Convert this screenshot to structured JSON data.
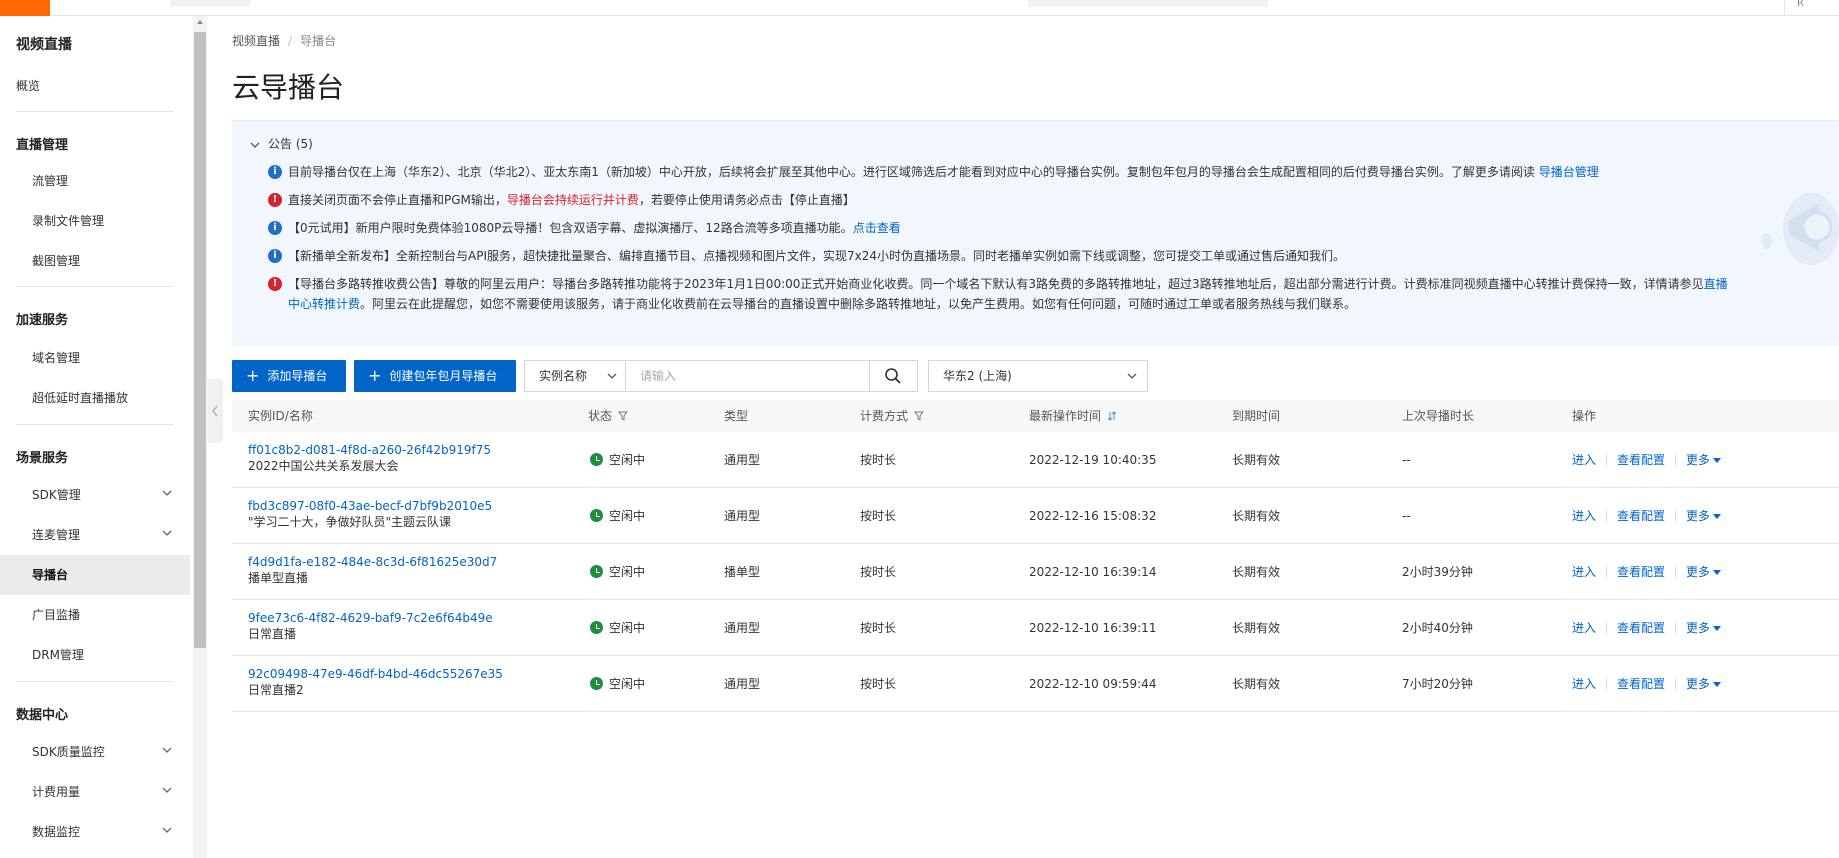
{
  "topbar": {
    "right_text": "R"
  },
  "sidebar": {
    "title": "视频直播",
    "overview": "概览",
    "groups": {
      "live_mgmt": "直播管理",
      "accel": "加速服务",
      "scene": "场景服务",
      "data_center": "数据中心"
    },
    "items": {
      "stream": "流管理",
      "record": "录制文件管理",
      "snapshot": "截图管理",
      "domain": "域名管理",
      "ultra": "超低延时直播播放",
      "sdk": "SDK管理",
      "mic": "连麦管理",
      "director": "导播台",
      "monitor": "广目监播",
      "drm": "DRM管理",
      "sdk_quality": "SDK质量监控",
      "billing": "计费用量",
      "data_monitor": "数据监控"
    }
  },
  "breadcrumb": {
    "root": "视频直播",
    "sep": "/",
    "current": "导播台"
  },
  "page_title": "云导播台",
  "notice": {
    "header": "公告 (5)",
    "rows": [
      {
        "type": "info",
        "text": "目前导播台仅在上海（华东2）、北京（华北2）、亚太东南1（新加坡）中心开放，后续将会扩展至其他中心。进行区域筛选后才能看到对应中心的导播台实例。复制包年包月的导播台会生成配置相同的后付费导播台实例。了解更多请阅读 ",
        "link": "导播台管理"
      },
      {
        "type": "warn",
        "text_a": "直接关闭页面不会停止直播和PGM输出，",
        "text_red": "导播台会持续运行并计费",
        "text_b": "，若要停止使用请务必点击【停止直播】"
      },
      {
        "type": "info",
        "text": "【0元试用】新用户限时免费体验1080P云导播！包含双语字幕、虚拟演播厅、12路合流等多项直播功能。",
        "link": "点击查看"
      },
      {
        "type": "info",
        "text": "【新播单全新发布】全新控制台与API服务，超快捷批量聚合、编排直播节目、点播视频和图片文件，实现7x24小时伪直播场景。同时老播单实例如需下线或调整，您可提交工单或通过售后通知我们。"
      },
      {
        "type": "warn",
        "text_a": "【导播台多路转推收费公告】尊敬的阿里云用户：导播台多路转推功能将于2023年1月1日00:00正式开始商业化收费。同一个域名下默认有3路免费的多路转推地址，超过3路转推地址后，超出部分需进行计费。计费标准同视频直播中心转推计费保持一致，详情请参见",
        "link": "直播中心转推计费",
        "text_b": "。阿里云在此提醒您，如您不需要使用该服务，请于商业化收费前在云导播台的直播设置中删除多路转推地址，以免产生费用。如您有任何问题，可随时通过工单或者服务热线与我们联系。"
      }
    ]
  },
  "toolbar": {
    "add_btn": "添加导播台",
    "create_btn": "创建包年包月导播台",
    "filter_select": "实例名称",
    "search_placeholder": "请输入",
    "region_select": "华东2 (上海)"
  },
  "table": {
    "headers": {
      "id": "实例ID/名称",
      "status": "状态",
      "type": "类型",
      "billing": "计费方式",
      "latest": "最新操作时间",
      "expire": "到期时间",
      "last_duration": "上次导播时长",
      "ops": "操作"
    },
    "ops": {
      "enter": "进入",
      "config": "查看配置",
      "more": "更多"
    },
    "rows": [
      {
        "id": "ff01c8b2-d081-4f8d-a260-26f42b919f75",
        "name": "2022中国公共关系发展大会",
        "status": "空闲中",
        "type": "通用型",
        "billing": "按时长",
        "latest": "2022-12-19 10:40:35",
        "expire": "长期有效",
        "last_duration": "--"
      },
      {
        "id": "fbd3c897-08f0-43ae-becf-d7bf9b2010e5",
        "name": "\"学习二十大，争做好队员\"主题云队课",
        "status": "空闲中",
        "type": "通用型",
        "billing": "按时长",
        "latest": "2022-12-16 15:08:32",
        "expire": "长期有效",
        "last_duration": "--"
      },
      {
        "id": "f4d9d1fa-e182-484e-8c3d-6f81625e30d7",
        "name": "播单型直播",
        "status": "空闲中",
        "type": "播单型",
        "billing": "按时长",
        "latest": "2022-12-10 16:39:14",
        "expire": "长期有效",
        "last_duration": "2小时39分钟"
      },
      {
        "id": "9fee73c6-4f82-4629-baf9-7c2e6f64b49e",
        "name": "日常直播",
        "status": "空闲中",
        "type": "通用型",
        "billing": "按时长",
        "latest": "2022-12-10 16:39:11",
        "expire": "长期有效",
        "last_duration": "2小时40分钟"
      },
      {
        "id": "92c09498-47e9-46df-b4bd-46dc55267e35",
        "name": "日常直播2",
        "status": "空闲中",
        "type": "通用型",
        "billing": "按时长",
        "latest": "2022-12-10 09:59:44",
        "expire": "长期有效",
        "last_duration": "7小时20分钟"
      }
    ]
  },
  "colors": {
    "accent": "#0064c8",
    "brand": "#ff6a00",
    "danger": "#d9222a",
    "success": "#1e8e3e"
  }
}
